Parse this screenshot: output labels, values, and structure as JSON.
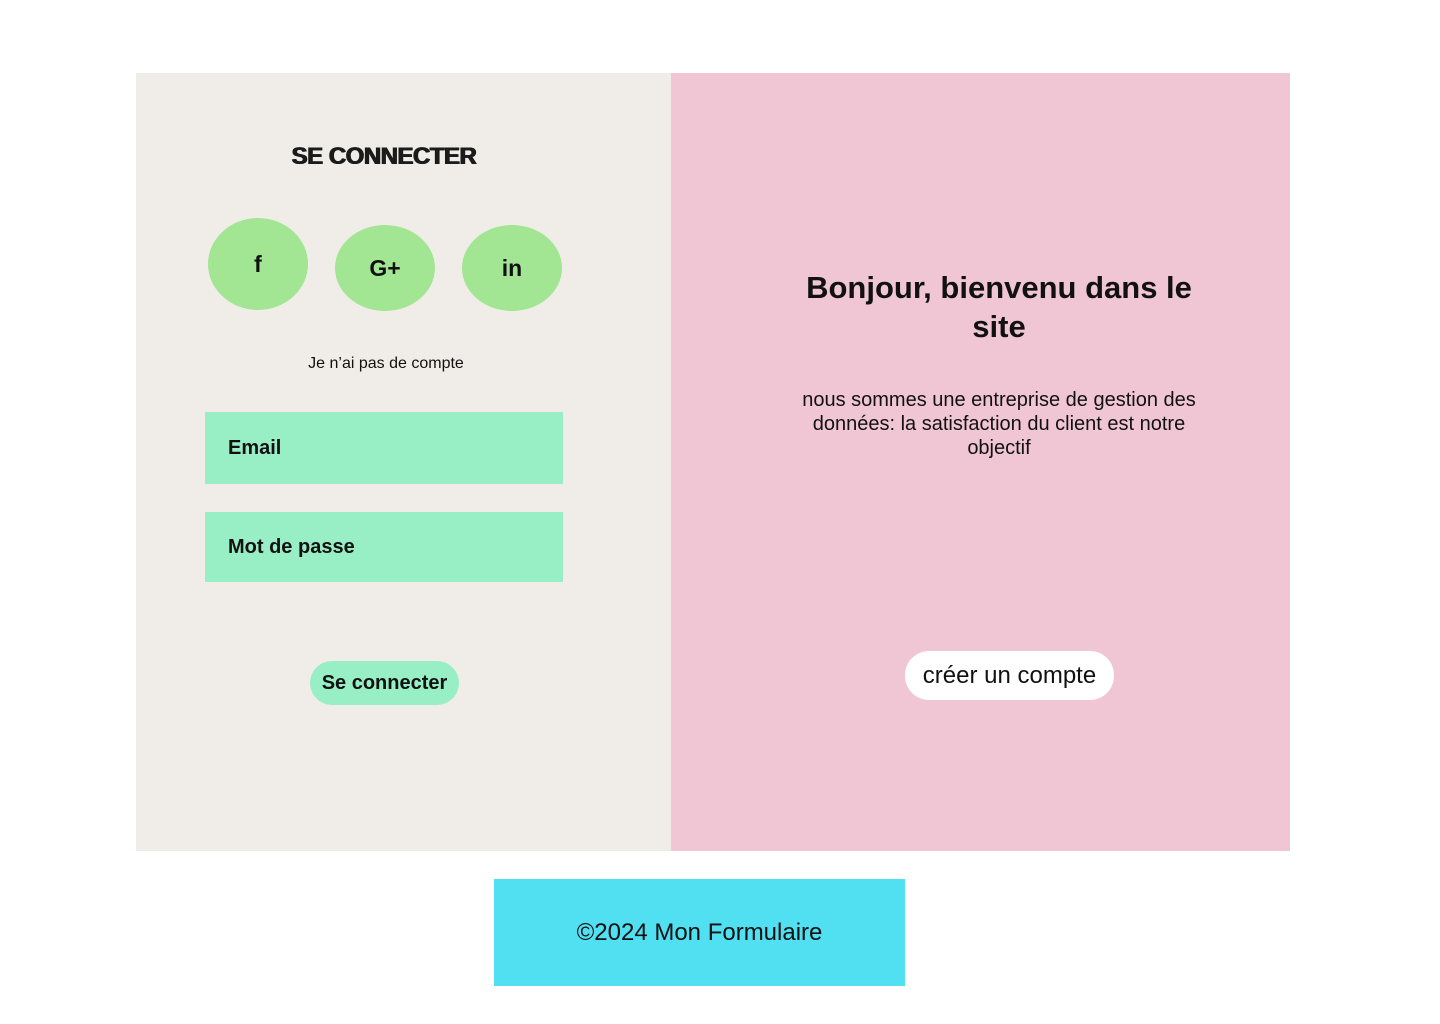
{
  "login": {
    "title": "SE CONNECTER",
    "social": [
      {
        "label": "f",
        "icon": "facebook-icon"
      },
      {
        "label": "G+",
        "icon": "google-plus-icon"
      },
      {
        "label": "in",
        "icon": "linkedin-icon"
      }
    ],
    "no_account_text": "Je n’ai pas de compte",
    "email_label": "Email",
    "password_label": "Mot de passe",
    "submit_label": "Se connecter"
  },
  "welcome": {
    "title": "Bonjour, bienvenu dans le site",
    "text": "nous sommes une entreprise de gestion des données: la satisfaction du client est notre objectif",
    "create_account_label": "créer un compte"
  },
  "footer": {
    "text": "©2024 Mon Formulaire"
  },
  "colors": {
    "left_panel_bg": "#f0ede9",
    "right_panel_bg": "#f0c6d4",
    "social_btn": "#a2e592",
    "field_bg": "#98efc5",
    "footer_bg": "#50e0f2"
  }
}
